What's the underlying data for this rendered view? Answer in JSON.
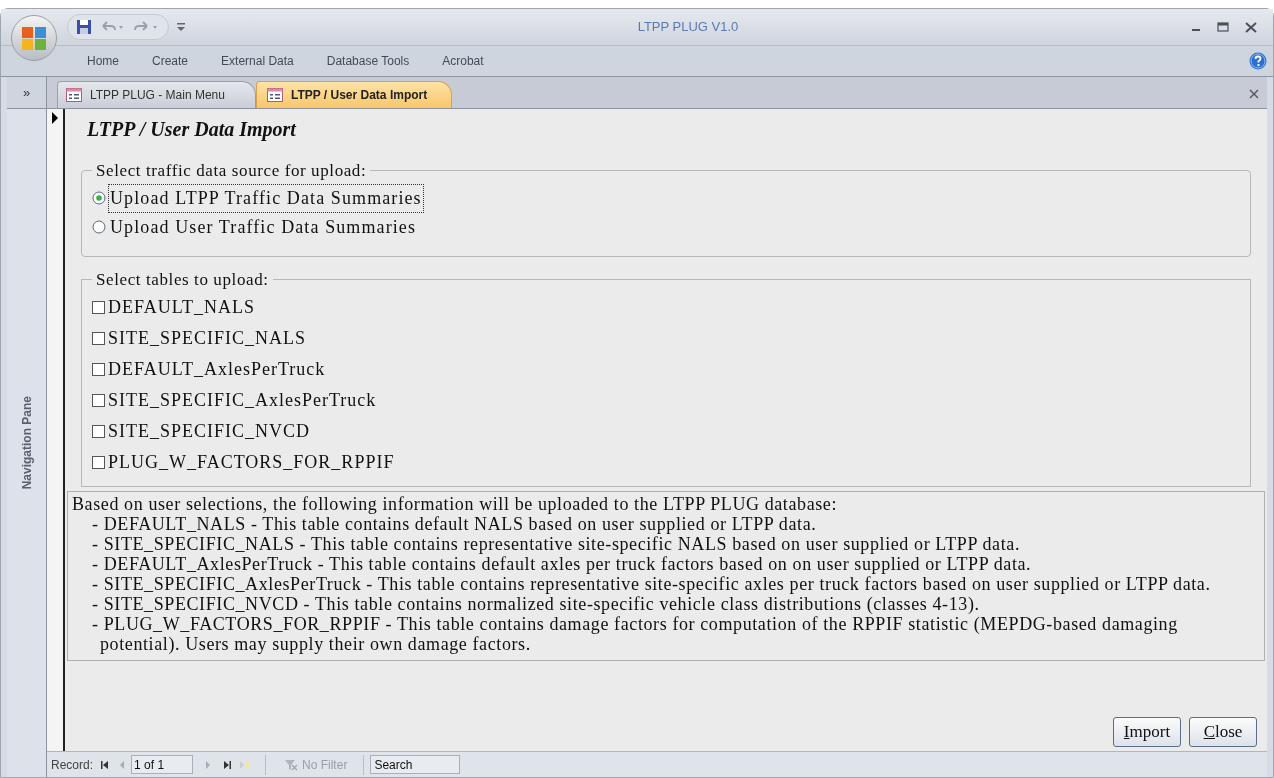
{
  "window": {
    "title": "LTPP PLUG V1.0"
  },
  "ribbon_tabs": [
    {
      "label": "Home"
    },
    {
      "label": "Create"
    },
    {
      "label": "External Data"
    },
    {
      "label": "Database Tools"
    },
    {
      "label": "Acrobat"
    }
  ],
  "navigation_pane": {
    "toggle": "»",
    "label": "Navigation Pane"
  },
  "document_tabs": [
    {
      "label": "LTPP PLUG - Main Menu",
      "selected": false
    },
    {
      "label": "LTPP / User Data Import",
      "selected": true
    }
  ],
  "form": {
    "title": "LTPP / User Data Import",
    "source_group": {
      "label": "Select traffic data source for upload:",
      "options": [
        {
          "label": "Upload LTPP Traffic Data Summaries",
          "selected": true
        },
        {
          "label": "Upload User Traffic Data Summaries",
          "selected": false
        }
      ]
    },
    "tables_group": {
      "label": "Select tables to upload:",
      "items": [
        {
          "label": "DEFAULT_NALS",
          "checked": false
        },
        {
          "label": "SITE_SPECIFIC_NALS",
          "checked": false
        },
        {
          "label": "DEFAULT_AxlesPerTruck",
          "checked": false
        },
        {
          "label": "SITE_SPECIFIC_AxlesPerTruck",
          "checked": false
        },
        {
          "label": "SITE_SPECIFIC_NVCD",
          "checked": false
        },
        {
          "label": "PLUG_W_FACTORS_FOR_RPPIF",
          "checked": false
        }
      ]
    },
    "info": {
      "intro": "Based on user selections, the following information will be uploaded to the LTPP PLUG database:",
      "items": [
        "- DEFAULT_NALS - This table contains default NALS based on user supplied or LTPP data.",
        "- SITE_SPECIFIC_NALS - This table contains representative site-specific NALS based on user supplied or LTPP data.",
        "- DEFAULT_AxlesPerTruck - This table contains default axles per truck factors based on on user supplied or LTPP data.",
        "- SITE_SPECIFIC_AxlesPerTruck - This table contains representative site-specific axles per truck factors based on user supplied or LTPP data.",
        "- SITE_SPECIFIC_NVCD - This table contains normalized site-specific vehicle class distributions (classes 4-13).",
        "- PLUG_W_FACTORS_FOR_RPPIF - This table contains damage factors for computation of the RPPIF statistic (MEPDG-based damaging potential). Users may supply their own damage factors."
      ]
    },
    "buttons": [
      {
        "label": "Import",
        "first_letter_underlined": true
      },
      {
        "label": "Close",
        "first_letter_underlined": true
      }
    ]
  },
  "status_bar": {
    "record_label": "Record:",
    "record_value": "1 of 1",
    "filter": "No Filter",
    "search": "Search"
  }
}
